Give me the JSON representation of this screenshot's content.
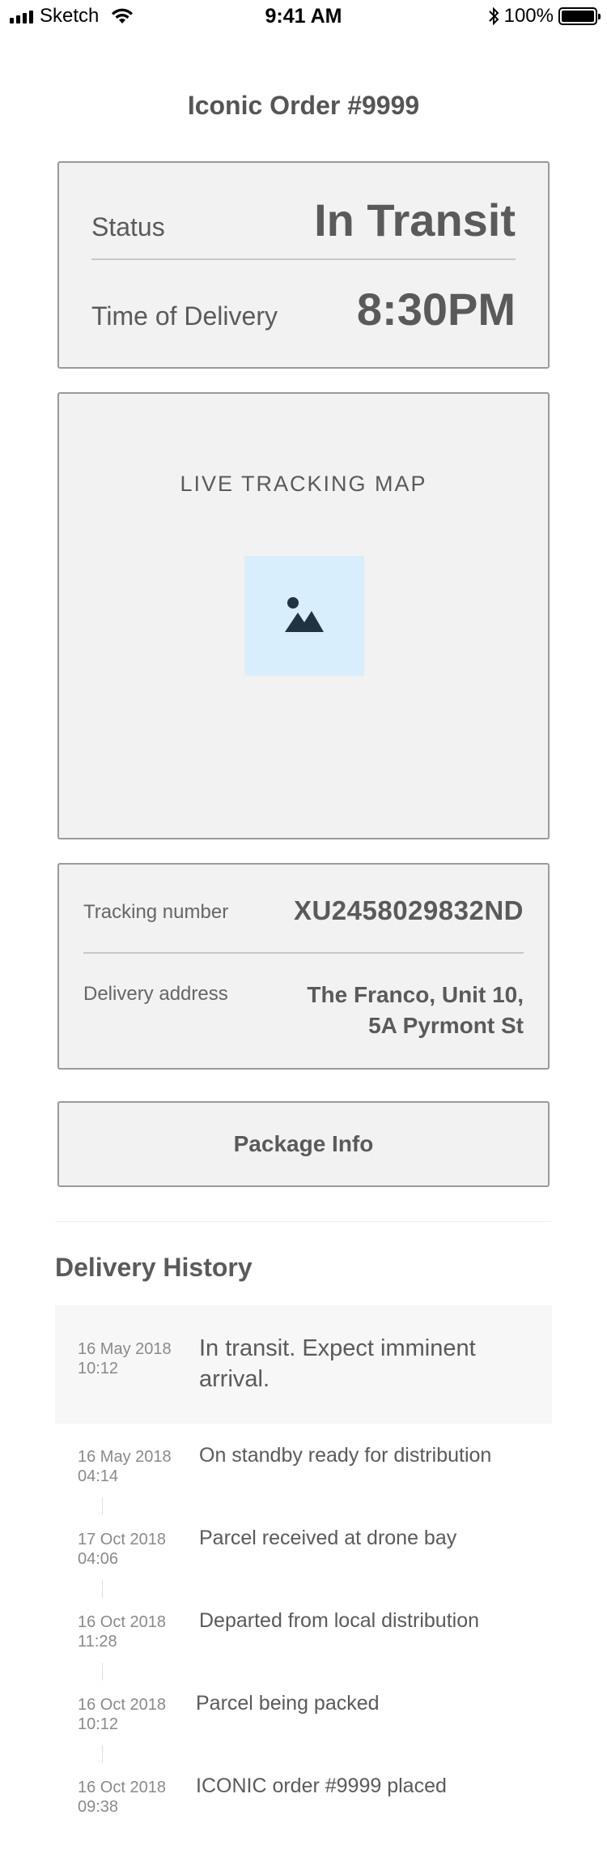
{
  "status_bar": {
    "carrier": "Sketch",
    "time": "9:41 AM",
    "battery": "100%",
    "icons": [
      "signal-icon",
      "wifi-icon",
      "bluetooth-icon",
      "battery-icon"
    ]
  },
  "header": {
    "title": "Iconic Order #9999"
  },
  "status_card": {
    "status_label": "Status",
    "status_value": "In Transit",
    "time_label": "Time of Delivery",
    "time_value": "8:30PM"
  },
  "map_card": {
    "heading": "LIVE TRACKING MAP",
    "image_icon": "image-placeholder-icon"
  },
  "tracking_card": {
    "tracking_label": "Tracking number",
    "tracking_value": "XU2458029832ND",
    "address_label": "Delivery address",
    "address_line1": "The Franco, Unit 10,",
    "address_line2": "5A Pyrmont St"
  },
  "package_button": {
    "label": "Package Info"
  },
  "history": {
    "title": "Delivery History",
    "entries": [
      {
        "date": "16 May 2018",
        "time": "10:12",
        "text_line1": "In transit. Expect imminent",
        "text_line2": "arrival."
      },
      {
        "date": "16 May 2018",
        "time": "04:14",
        "text_line1": "On standby ready for distribution"
      },
      {
        "date": "17 Oct 2018",
        "time": "04:06",
        "text_line1": "Parcel received at drone bay"
      },
      {
        "date": "16 Oct 2018",
        "time": "11:28",
        "text_line1": "Departed from local distribution"
      },
      {
        "date": "16 Oct 2018",
        "time": "10:12",
        "text_line1": "Parcel being packed"
      },
      {
        "date": "16 Oct 2018",
        "time": "09:38",
        "text_line1": "ICONIC order #9999 placed"
      }
    ]
  },
  "colors": {
    "card_background": "#f2f2f2",
    "card_border": "#9a9a9a",
    "text": "#5a5a5a",
    "map_placeholder": "#d9eefc",
    "icon_dark": "#1f3344"
  }
}
